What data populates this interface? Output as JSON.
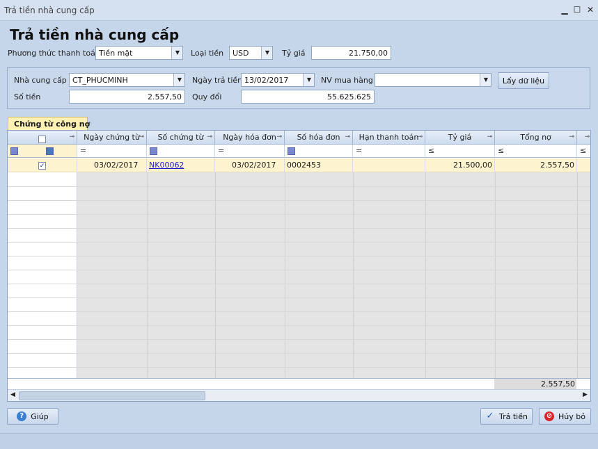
{
  "window": {
    "title": "Trả tiền nhà cung cấp"
  },
  "page": {
    "heading": "Trả tiền nhà cung cấp"
  },
  "top_form": {
    "payment_method_label": "Phương thức thanh toán",
    "payment_method_value": "Tiền mặt",
    "currency_label": "Loại tiền",
    "currency_value": "USD",
    "rate_label": "Tỷ giá",
    "rate_value": "21.750,00"
  },
  "filter": {
    "supplier_label": "Nhà cung cấp",
    "supplier_value": "CT_PHUCMINH",
    "pay_date_label": "Ngày trả tiền",
    "pay_date_value": "13/02/2017",
    "buyer_label": "NV mua hàng",
    "buyer_value": "",
    "fetch_button": "Lấy dữ liệu",
    "amount_label": "Số tiền",
    "amount_value": "2.557,50",
    "converted_label": "Quy đổi",
    "converted_value": "55.625.625"
  },
  "tab": {
    "label": "Chứng từ công nợ"
  },
  "grid": {
    "columns": [
      "Ngày chứng từ",
      "Số chứng từ",
      "Ngày hóa đơn",
      "Số hóa đơn",
      "Hạn thanh toán",
      "Tỷ giá",
      "Tổng nợ"
    ],
    "filter_ops": [
      "=",
      "=",
      "=",
      "=",
      "=",
      "≤",
      "≤"
    ],
    "rows": [
      {
        "checked": "✓",
        "doc_date": "03/02/2017",
        "doc_no": "NK00062",
        "invoice_date": "03/02/2017",
        "invoice_no": "0002453",
        "due": "",
        "rate": "21.500,00",
        "total": "2.557,50"
      }
    ],
    "footer_total": "2.557,50"
  },
  "buttons": {
    "help": "Giúp",
    "pay": "Trả tiền",
    "cancel": "Hủy bỏ"
  }
}
